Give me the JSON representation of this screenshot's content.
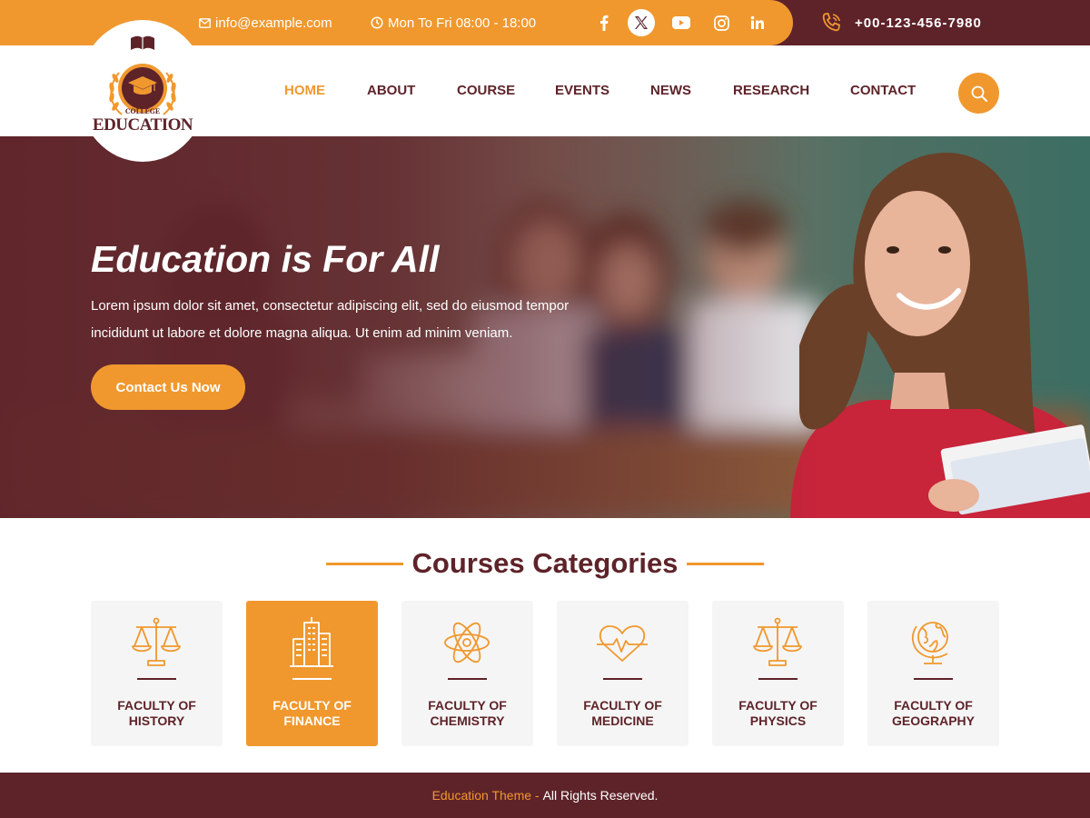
{
  "colors": {
    "primary": "#5e2329",
    "accent": "#f0982e",
    "card_bg": "#f5f5f5",
    "white": "#ffffff"
  },
  "topbar": {
    "email": "info@example.com",
    "hours": "Mon To Fri 08:00 - 18:00",
    "social": [
      "facebook-icon",
      "x-twitter-icon",
      "youtube-icon",
      "instagram-icon",
      "linkedin-icon"
    ],
    "phone": "+00-123-456-7980"
  },
  "logo": {
    "small": "COLLEGE",
    "text": "EDUCATION",
    "badge": "EST. 1906"
  },
  "nav": {
    "items": [
      {
        "label": "HOME",
        "active": true
      },
      {
        "label": "ABOUT"
      },
      {
        "label": "COURSE"
      },
      {
        "label": "EVENTS"
      },
      {
        "label": "NEWS"
      },
      {
        "label": "RESEARCH"
      },
      {
        "label": "CONTACT"
      }
    ],
    "search_icon": "search-icon"
  },
  "hero": {
    "title": "Education is For All",
    "text": "Lorem ipsum dolor sit amet, consectetur adipiscing elit, sed do eiusmod tempor incididunt ut labore et dolore magna aliqua. Ut enim ad minim veniam.",
    "button": "Contact Us Now"
  },
  "courses": {
    "title": "Courses Categories",
    "cards": [
      {
        "line1": "FACULTY OF",
        "line2": "HISTORY",
        "icon": "scales-icon"
      },
      {
        "line1": "FACULTY OF",
        "line2": "FINANCE",
        "icon": "buildings-icon",
        "active": true
      },
      {
        "line1": "FACULTY OF",
        "line2": "CHEMISTRY",
        "icon": "atom-icon"
      },
      {
        "line1": "FACULTY OF",
        "line2": "MEDICINE",
        "icon": "heartbeat-icon"
      },
      {
        "line1": "FACULTY OF",
        "line2": "PHYSICS",
        "icon": "scales-icon"
      },
      {
        "line1": "FACULTY OF",
        "line2": "GEOGRAPHY",
        "icon": "globe-icon"
      }
    ]
  },
  "footer": {
    "brand": "Education Theme -",
    "text": "All Rights Reserved."
  }
}
